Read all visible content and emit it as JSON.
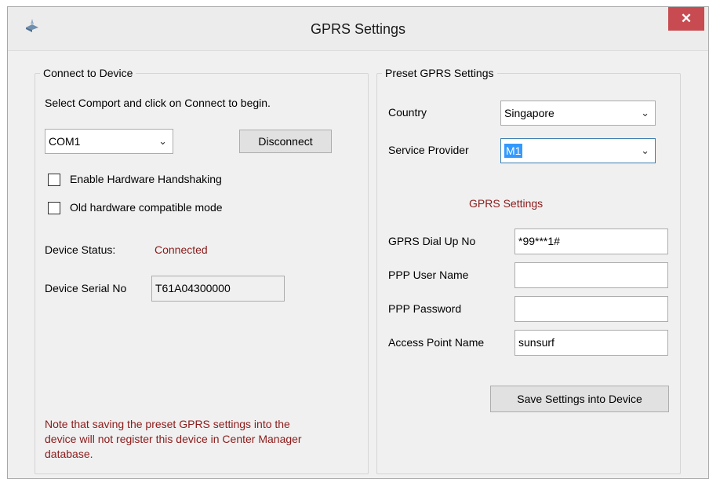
{
  "window": {
    "title": "GPRS Settings",
    "close_glyph": "✕"
  },
  "connect": {
    "group_title": "Connect to Device",
    "instruction": "Select Comport and click on Connect to begin.",
    "comport_value": "COM1",
    "disconnect_label": "Disconnect",
    "handshaking_label": "Enable Hardware Handshaking",
    "handshaking_checked": false,
    "oldhw_label": "Old hardware compatible mode",
    "oldhw_checked": false,
    "status_label": "Device Status:",
    "status_value": "Connected",
    "serial_label": "Device Serial No",
    "serial_value": "T61A04300000",
    "note": "Note that saving the preset GPRS settings into the device will not register this device in Center Manager database."
  },
  "preset": {
    "group_title": "Preset GPRS Settings",
    "country_label": "Country",
    "country_value": "Singapore",
    "provider_label": "Service Provider",
    "provider_value": "M1",
    "section_title": "GPRS Settings",
    "dialup_label": "GPRS Dial Up No",
    "dialup_value": "*99***1#",
    "ppp_user_label": "PPP User Name",
    "ppp_user_value": "",
    "ppp_pass_label": "PPP Password",
    "ppp_pass_value": "",
    "apn_label": "Access Point Name",
    "apn_value": "sunsurf",
    "save_label": "Save Settings into Device"
  },
  "colors": {
    "accent_red": "#8b1a1a",
    "close_red": "#c74b50",
    "selection_blue": "#3399ff"
  },
  "icons": {
    "app": "app-icon",
    "dropdown": "chevron-down-icon",
    "close": "close-icon"
  }
}
